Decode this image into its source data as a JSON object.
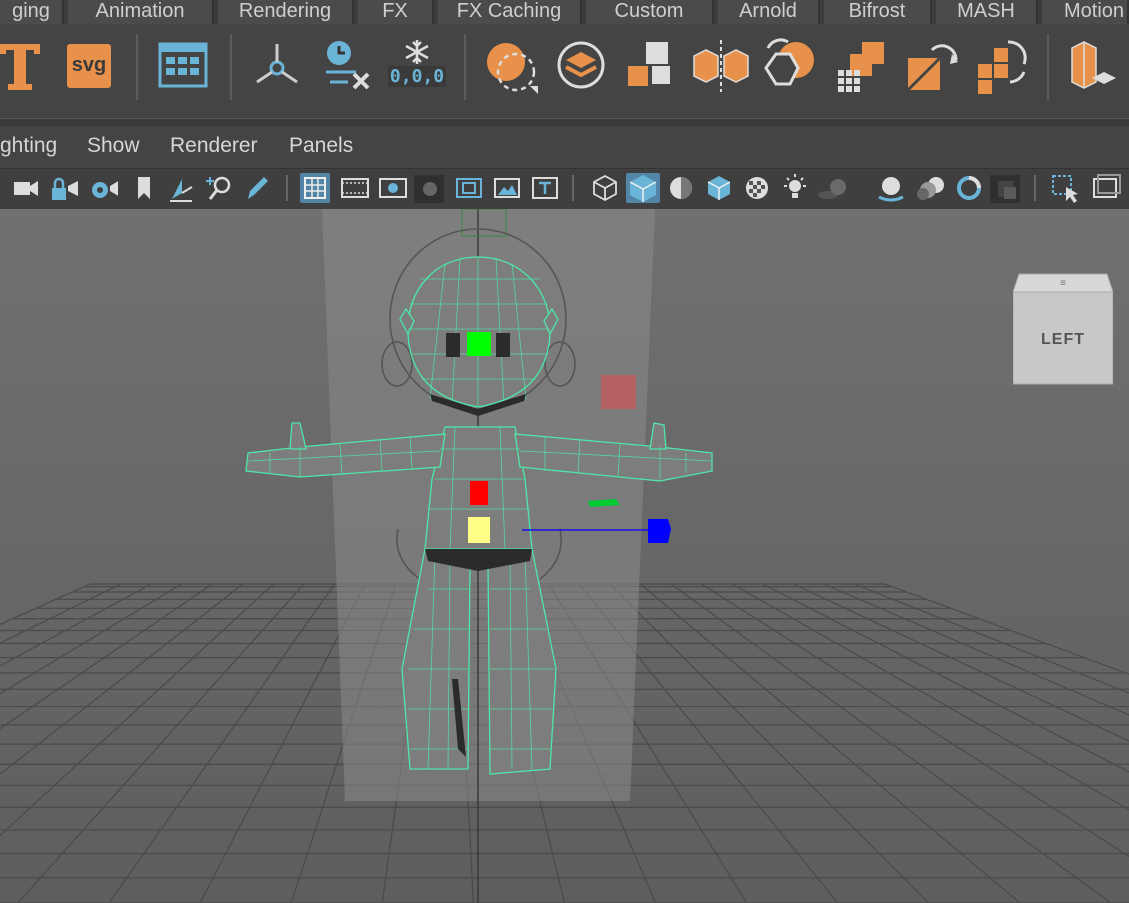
{
  "shelf_tabs": [
    "ging",
    "Animation",
    "Rendering",
    "FX",
    "FX Caching",
    "Custom",
    "Arnold",
    "Bifrost",
    "MASH",
    "Motion"
  ],
  "shelf_icons": [
    "text-tool-icon",
    "svg-tool-icon",
    "panel-layout-icon",
    "motion-trail-icon",
    "clear-timing-icon",
    "freeze-transform-icon",
    "mash-sphere-icon",
    "layer-stack-icon",
    "blocks-icon",
    "mirror-cubes-icon",
    "replace-geo-icon",
    "grid-cubes-icon",
    "transfer-icon",
    "cycle-cubes-icon",
    "rotate-cubes-icon",
    "instancer-icon"
  ],
  "svg_label": "svg",
  "coord_label": "0,0,0",
  "panel_menu": [
    "ghting",
    "Show",
    "Renderer",
    "Panels"
  ],
  "panel_toolbar_icons": [
    "camera-icon",
    "lock-camera-icon",
    "camera-attributes-icon",
    "bookmark-icon",
    "image-plane-icon",
    "camera-zoom-icon",
    "grease-pencil-icon",
    "grid-icon",
    "film-gate-icon",
    "resolution-gate-icon",
    "gate-mask-icon",
    "field-chart-icon",
    "safe-action-icon",
    "safe-title-icon",
    "wireframe-icon",
    "smooth-shade-icon",
    "default-material-icon",
    "wireframe-on-shaded-icon",
    "textured-icon",
    "use-lights-icon",
    "shadows-icon",
    "screen-space-ao-icon",
    "motion-blur-icon",
    "anti-alias-icon",
    "depth-of-field-icon",
    "isolate-select-icon",
    "xray-icon"
  ],
  "viewcube_label": "LEFT",
  "colors": {
    "wire": "#4de8a8",
    "manip_green": "#00ff00",
    "manip_red": "#ff0000",
    "manip_yellow": "#ffff88",
    "manip_blue": "#0000ff",
    "active_button": "#5285a6",
    "shelf_orange": "#e8914a"
  }
}
